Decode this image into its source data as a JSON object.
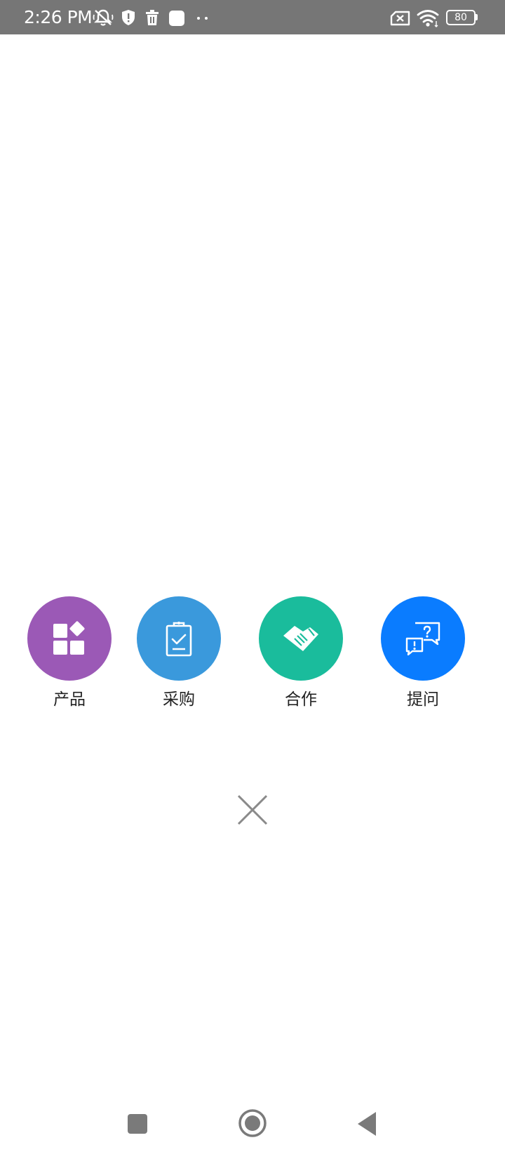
{
  "status_bar": {
    "time": "2:26 PM",
    "battery": "80",
    "icons": [
      "mute-icon",
      "shield-icon",
      "trash-icon",
      "square-app-icon",
      "more-dots-icon",
      "sim-x-icon",
      "wifi-icon",
      "battery-icon"
    ]
  },
  "actions": [
    {
      "label": "产品",
      "color": "#9b59b6",
      "icon": "product-grid-icon"
    },
    {
      "label": "采购",
      "color": "#3a99dc",
      "icon": "clipboard-check-icon"
    },
    {
      "label": "合作",
      "color": "#1abc9c",
      "icon": "handshake-icon"
    },
    {
      "label": "提问",
      "color": "#0a7cff",
      "icon": "question-chat-icon"
    }
  ],
  "close": {
    "icon": "close-icon"
  },
  "nav": {
    "icons": [
      "recent-apps-icon",
      "home-icon",
      "back-icon"
    ]
  }
}
